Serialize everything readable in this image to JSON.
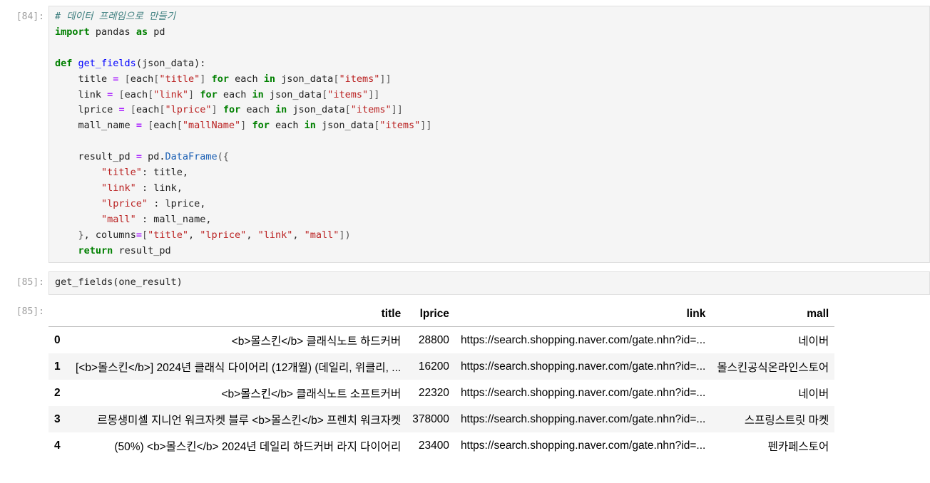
{
  "cells": [
    {
      "prompt": "[84]:"
    },
    {
      "prompt": "[85]:",
      "code": "get_fields(one_result)"
    },
    {
      "prompt": "[85]:"
    }
  ],
  "code_84": {
    "comment": "# 데이터 프레임으로 만들기",
    "kw_import": "import",
    "mod_pandas": "pandas",
    "kw_as": "as",
    "alias_pd": "pd",
    "kw_def": "def",
    "fn_name": "get_fields",
    "param": "(json_data):",
    "var_title": "title",
    "var_link": "link",
    "var_lprice": "lprice",
    "var_mall_name": "mall_name",
    "kw_for": "for",
    "kw_in": "in",
    "each": "each",
    "json_data": "json_data",
    "s_title": "\"title\"",
    "s_link": "\"link\"",
    "s_lprice": "\"lprice\"",
    "s_mallName": "\"mallName\"",
    "s_items": "\"items\"",
    "s_mall": "\"mall\"",
    "result_pd": "result_pd",
    "pd_dot": "pd.",
    "DataFrame": "DataFrame",
    "columns": "columns",
    "kw_return": "return"
  },
  "table": {
    "columns": [
      "title",
      "lprice",
      "link",
      "mall"
    ],
    "rows": [
      {
        "index": "0",
        "title": "<b>몰스킨</b> 클래식노트 하드커버",
        "lprice": "28800",
        "link": "https://search.shopping.naver.com/gate.nhn?id=...",
        "mall": "네이버"
      },
      {
        "index": "1",
        "title": "[<b>몰스킨</b>] 2024년 클래식 다이어리 (12개월) (데일리, 위클리, ...",
        "lprice": "16200",
        "link": "https://search.shopping.naver.com/gate.nhn?id=...",
        "mall": "몰스킨공식온라인스토어"
      },
      {
        "index": "2",
        "title": "<b>몰스킨</b> 클래식노트 소프트커버",
        "lprice": "22320",
        "link": "https://search.shopping.naver.com/gate.nhn?id=...",
        "mall": "네이버"
      },
      {
        "index": "3",
        "title": "르몽생미셸 지니언 워크자켓 블루 <b>몰스킨</b> 프렌치 워크자켓",
        "lprice": "378000",
        "link": "https://search.shopping.naver.com/gate.nhn?id=...",
        "mall": "스프링스트릿 마켓"
      },
      {
        "index": "4",
        "title": "(50%) <b>몰스킨</b> 2024년 데일리 하드커버 라지 다이어리",
        "lprice": "23400",
        "link": "https://search.shopping.naver.com/gate.nhn?id=...",
        "mall": "펜카페스토어"
      }
    ]
  }
}
